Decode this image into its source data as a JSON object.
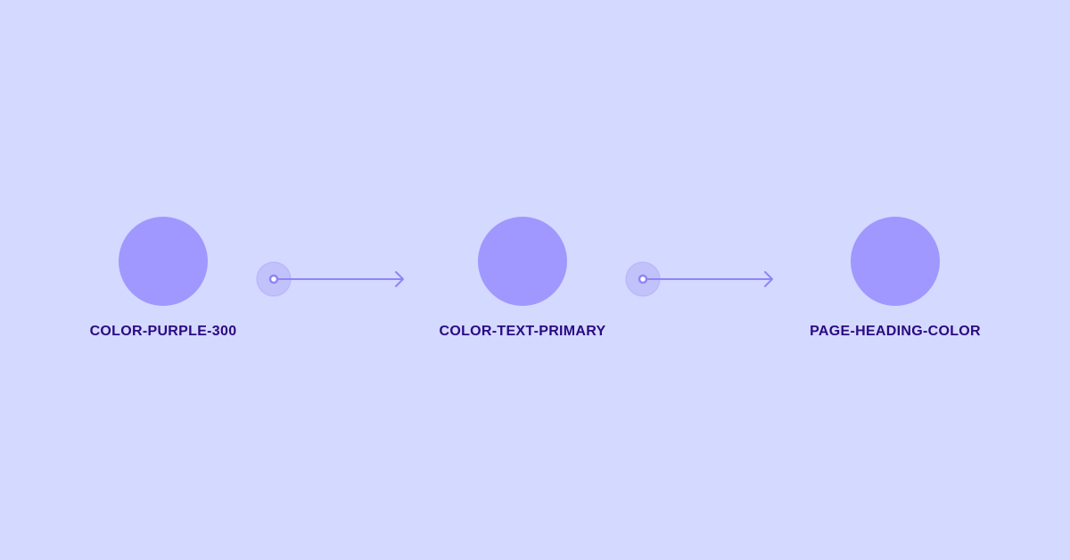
{
  "colors": {
    "background": "#d4d9ff",
    "swatch": "#a097ff",
    "label": "#2a0a82",
    "connector": "#8f85f5",
    "connector_halo": "#c2c2fb",
    "connector_dot": "#ffffff"
  },
  "tokens": [
    {
      "name": "COLOR-PURPLE-300"
    },
    {
      "name": "COLOR-TEXT-PRIMARY"
    },
    {
      "name": "PAGE-HEADING-COLOR"
    }
  ],
  "connectors": [
    {
      "icon": "arrow-right-icon"
    },
    {
      "icon": "arrow-right-icon"
    }
  ]
}
